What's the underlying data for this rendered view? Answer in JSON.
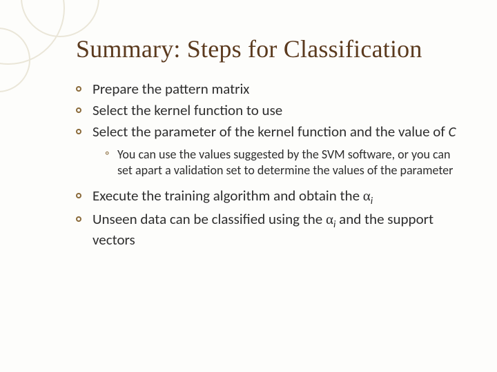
{
  "title": "Summary: Steps for Classification",
  "bullets": {
    "b1": "Prepare the pattern matrix",
    "b2": "Select the kernel function to use",
    "b3_prefix": "Select the parameter of the kernel function and the value of ",
    "b3_var": "C",
    "b3_sub1": "You can use the values suggested by the SVM software, or you can set apart a validation set to determine the values of the parameter",
    "b4_prefix": "Execute the training algorithm and obtain the ",
    "b5_prefix": "Unseen data can be classified using the ",
    "b5_suffix": " and the support vectors",
    "alpha": "α",
    "sub_i": "i"
  }
}
